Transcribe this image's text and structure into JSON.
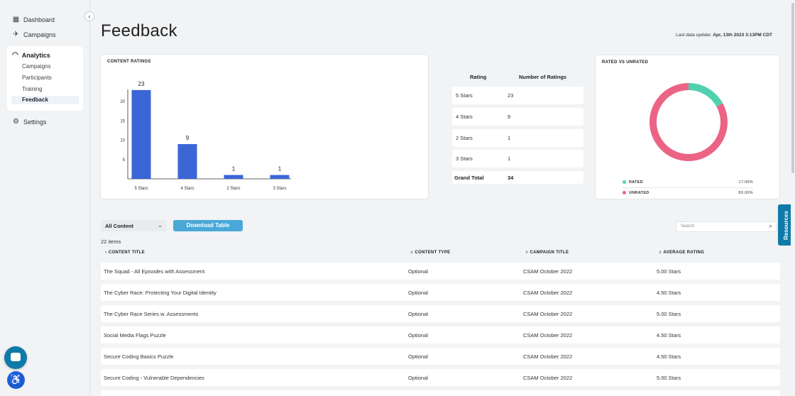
{
  "sidebar": {
    "dashboard": "Dashboard",
    "campaigns": "Campaigns",
    "analytics": {
      "label": "Analytics",
      "items": [
        "Campaigns",
        "Participants",
        "Training",
        "Feedback"
      ],
      "active": "Feedback"
    },
    "settings": "Settings"
  },
  "header": {
    "title": "Feedback",
    "last_update_label": "Last data update:",
    "last_update_value": "Apr, 13th 2023 3:13PM CDT"
  },
  "content_ratings": {
    "title": "CONTENT RATINGS"
  },
  "chart_data": [
    {
      "type": "bar",
      "title": "CONTENT RATINGS",
      "categories": [
        "5 Stars",
        "4 Stars",
        "2 Stars",
        "3 Stars"
      ],
      "values": [
        23,
        9,
        1,
        1
      ],
      "yticks": [
        5,
        10,
        15,
        20
      ],
      "ylim": [
        0,
        25
      ],
      "color": "#3a66d6"
    },
    {
      "type": "pie",
      "title": "RATED VS UNRATED",
      "labels": [
        "RATED",
        "UNRATED"
      ],
      "values": [
        17.0,
        83.0
      ],
      "value_labels": [
        "17.00%",
        "83.00%"
      ],
      "colors": [
        "#4fd1b0",
        "#ec6485"
      ]
    }
  ],
  "ratings_table": {
    "headers": [
      "Rating",
      "Number of Ratings"
    ],
    "rows": [
      {
        "rating": "5 Stars",
        "count": "23"
      },
      {
        "rating": "4 Stars",
        "count": "9"
      },
      {
        "rating": "2 Stars",
        "count": "1"
      },
      {
        "rating": "3 Stars",
        "count": "1"
      }
    ],
    "total_label": "Grand Total",
    "total_value": "34"
  },
  "rated_unrated": {
    "title": "RATED VS UNRATED",
    "legend": [
      {
        "label": "RATED",
        "pct": "17.00%",
        "color": "#4fd1b0"
      },
      {
        "label": "UNRATED",
        "pct": "83.00%",
        "color": "#ec6485"
      }
    ]
  },
  "filters": {
    "select_value": "All Content",
    "download_label": "Download Table",
    "search_placeholder": "Search",
    "items_count": "22 items"
  },
  "table": {
    "headers": [
      "CONTENT TITLE",
      "CONTENT TYPE",
      "CAMPAIGN TITLE",
      "AVERAGE RATING"
    ],
    "rows": [
      [
        "The Squad - All Episodes with Assessment",
        "Optional",
        "CSAM October 2022",
        "5.00 Stars"
      ],
      [
        "The Cyber Race: Protecting Your Digital Identity",
        "Optional",
        "CSAM October 2022",
        "4.50 Stars"
      ],
      [
        "The Cyber Race Series w. Assessments",
        "Optional",
        "CSAM October 2022",
        "5.00 Stars"
      ],
      [
        "Social Media Flags Puzzle",
        "Optional",
        "CSAM October 2022",
        "4.50 Stars"
      ],
      [
        "Secure Coding Basics Puzzle",
        "Optional",
        "CSAM October 2022",
        "4.50 Stars"
      ],
      [
        "Secure Coding - Vulnerable Dependencies",
        "Optional",
        "CSAM October 2022",
        "5.00 Stars"
      ]
    ]
  },
  "resources_label": "Resources"
}
